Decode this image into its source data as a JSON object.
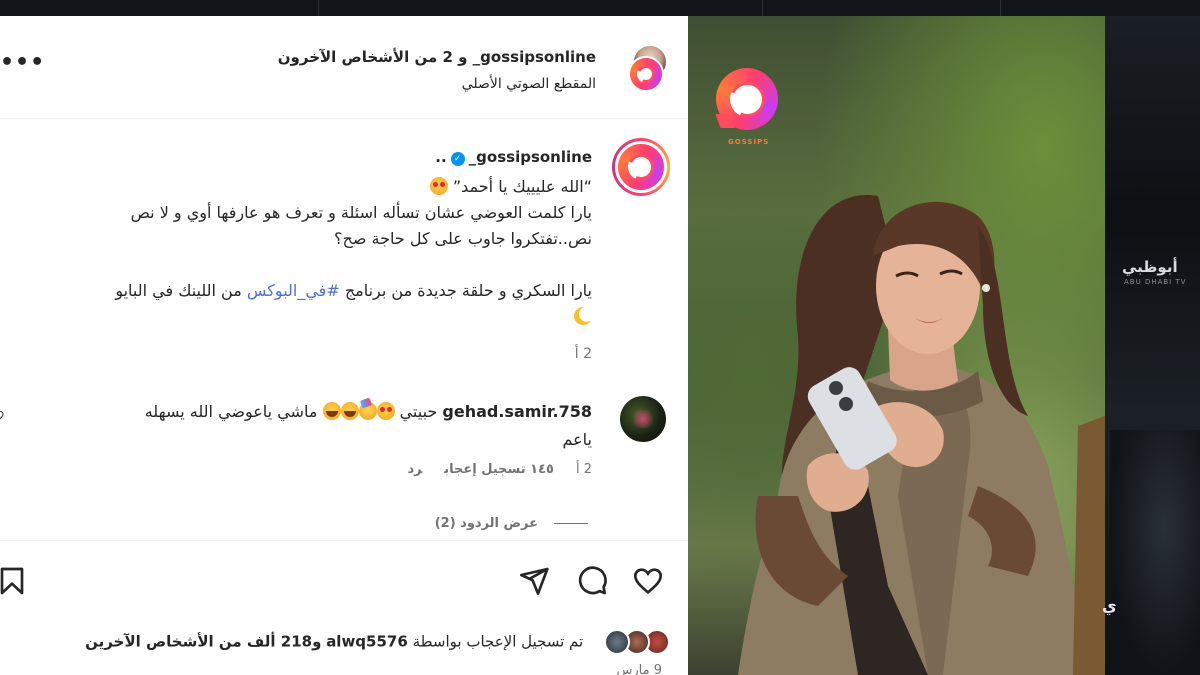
{
  "header": {
    "title": "gossipsonline_ و 2 من الأشخاص الآخرون",
    "audio": "المقطع الصوتي الأصلي",
    "more_icon": "more-horizontal-icon",
    "more": "•••"
  },
  "caption": {
    "username": "gossipsonline_",
    "verified": "✓",
    "trail": "..",
    "lines": [
      "“الله عليييك يا أحمد”",
      "يارا كلمت العوضي عشان تسأله اسئلة و تعرف هو عارفها أوي و لا نص",
      "نص..تفتكروا جاوب على كل حاجة صح؟",
      "يارا السكري و حلقة جديدة من برنامج",
      "من اللينك في البايو"
    ],
    "hashtag": "#في_البوكس",
    "time": "2 أ"
  },
  "comment": {
    "username": "gehad.samir.758",
    "text_a": "حبيتي",
    "text_b": "ماشي ياعوضي الله يسهله",
    "text_c": "ياعم",
    "time": "2 أ",
    "likes": "١٤٥ تسجيل إعجاب",
    "reply": "رد",
    "view_replies": "عرض الردود (2)"
  },
  "actions": {
    "like_icon": "heart-icon",
    "comment_icon": "comment-icon",
    "share_icon": "send-icon",
    "save_icon": "bookmark-icon"
  },
  "likes": {
    "prefix": "تم تسجيل الإعجاب بواسطة",
    "user": "alwq5576",
    "suffix": "و218 ألف من الأشخاص الآخرين"
  },
  "date": "9 مارس",
  "video": {
    "logo_text": "GOSSIPS"
  },
  "backdrop": {
    "channel": "أبوظبي",
    "channel_sub": "ABU DHABI TV",
    "edge_letter": "ي"
  },
  "colors": {
    "accent": "#0095f6",
    "hashtag": "#4f6fd6",
    "brand_pink": "#ff3d6e",
    "brand_orange": "#ff7a3a"
  }
}
